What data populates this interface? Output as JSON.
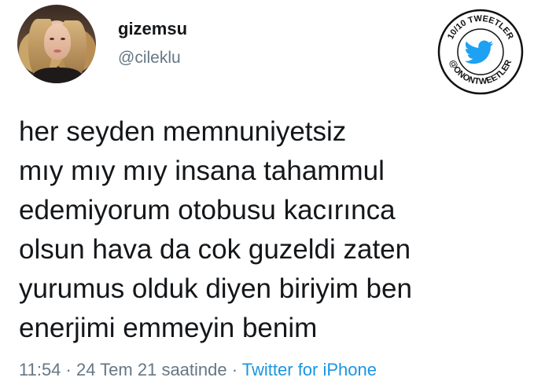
{
  "user": {
    "display_name": "gizemsu",
    "handle": "@cileklu"
  },
  "badge": {
    "top_text": "10/10 TWEETLER",
    "bottom_text": "@ONONTWEETLER",
    "icon": "twitter-bird-icon",
    "accent_color": "#1da1f2"
  },
  "tweet": {
    "lines": [
      "her seyden memnuniyetsiz",
      "mıy mıy mıy insana tahammul",
      "edemiyorum otobusu kacırınca",
      "olsun hava da cok guzeldi zaten",
      "yurumus olduk diyen biriyim ben",
      "enerjimi emmeyin benim"
    ]
  },
  "meta": {
    "time": "11:54",
    "date": "24 Tem 21 saatinde",
    "separator": "·",
    "source": "Twitter for iPhone"
  },
  "colors": {
    "text": "#14171a",
    "secondary": "#657786",
    "link": "#1b95e0"
  }
}
